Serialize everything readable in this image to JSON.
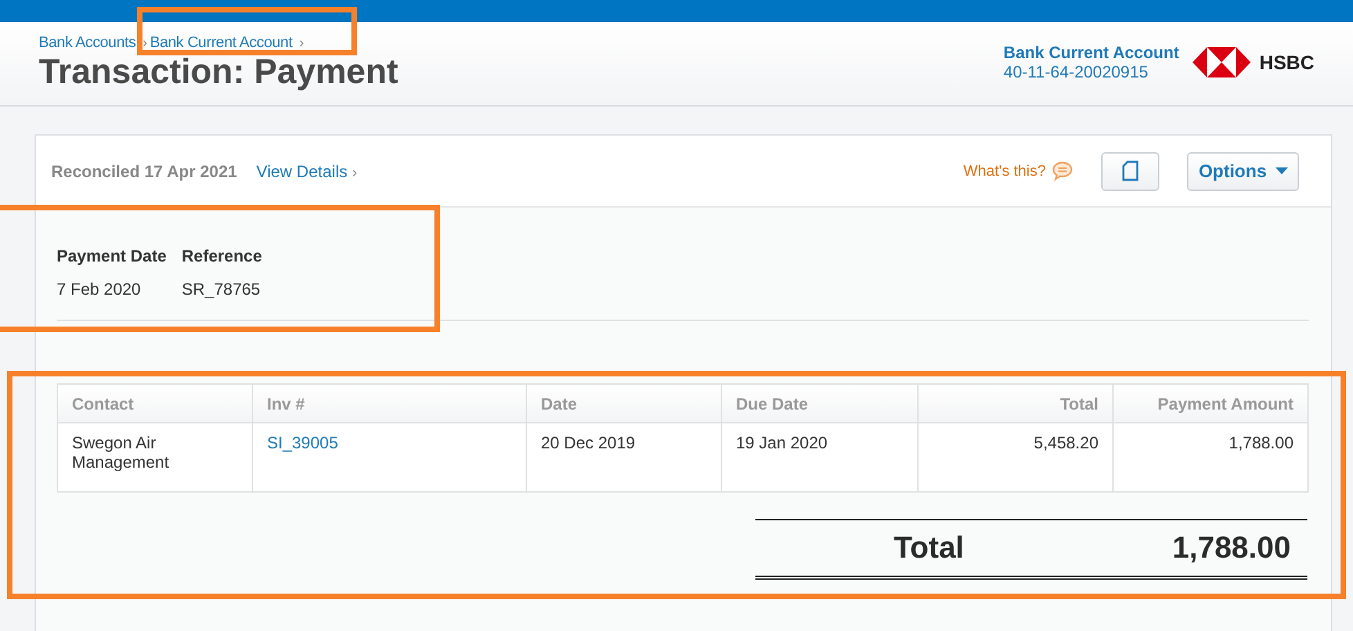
{
  "breadcrumb": [
    {
      "label": "Bank Accounts",
      "separator": "›"
    },
    {
      "label": "Bank Current Account",
      "separator": "›"
    }
  ],
  "title": "Transaction: Payment",
  "account": {
    "name": "Bank Current Account",
    "number": "40-11-64-20020915",
    "bank": "HSBC"
  },
  "status": {
    "reconciled": "Reconciled 17 Apr 2021",
    "link": "View Details",
    "link_arrow": "›"
  },
  "help": {
    "label": "What's this?"
  },
  "options_button": {
    "label": "Options"
  },
  "details": [
    {
      "label": "Payment Date",
      "value": "7 Feb 2020"
    },
    {
      "label": "Reference",
      "value": "SR_78765"
    }
  ],
  "table": {
    "columns": [
      {
        "label": "Contact"
      },
      {
        "label": "Inv #"
      },
      {
        "label": "Date"
      },
      {
        "label": "Due Date"
      },
      {
        "label": "Total"
      },
      {
        "label": "Payment Amount"
      }
    ],
    "rows": [
      {
        "cells": [
          {
            "text": "Swegon Air Management",
            "kind": "text"
          },
          {
            "text": "SI_39005",
            "kind": "link"
          },
          {
            "text": "20 Dec 2019",
            "kind": "text"
          },
          {
            "text": "19 Jan 2020",
            "kind": "text"
          },
          {
            "text": "5,458.20",
            "kind": "text"
          },
          {
            "text": "1,788.00",
            "kind": "text"
          }
        ]
      }
    ]
  },
  "total": {
    "label": "Total",
    "value": "1,788.00"
  }
}
